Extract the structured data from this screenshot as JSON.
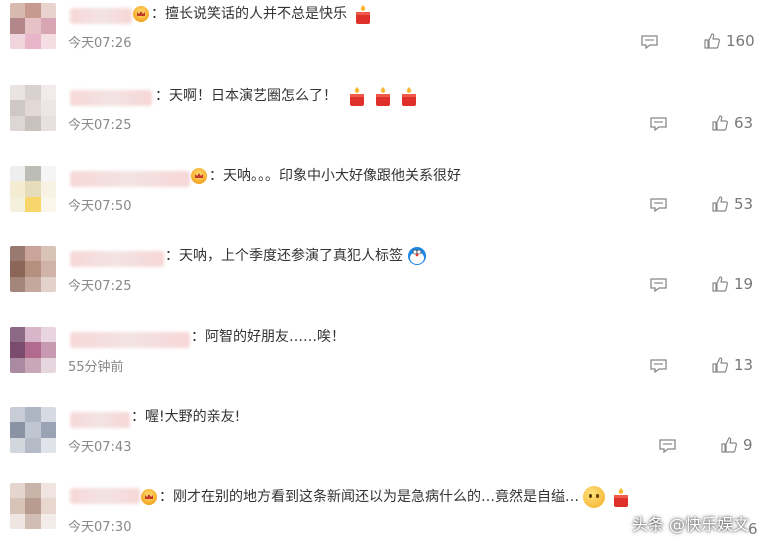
{
  "comments": [
    {
      "name_hidden": true,
      "badge": "vip-crown",
      "text": "：擅长说笑话的人并不总是快乐",
      "emoji": [
        "candle"
      ],
      "time": "今天07:26",
      "likes": "160"
    },
    {
      "name_hidden": true,
      "badge": "",
      "text": "：天啊！日本演艺圈怎么了！",
      "emoji": [
        "candle",
        "candle",
        "candle"
      ],
      "time": "今天07:25",
      "likes": "63"
    },
    {
      "name_hidden": true,
      "badge": "vip-crown",
      "text": "：天呐。。。印象中小大好像跟他关系很好",
      "emoji": [],
      "time": "今天07:50",
      "likes": "53"
    },
    {
      "name_hidden": true,
      "badge": "",
      "text": "：天呐，上个季度还参演了真犯人标签",
      "emoji": [
        "doraemon"
      ],
      "time": "今天07:25",
      "likes": "19"
    },
    {
      "name_hidden": true,
      "badge": "",
      "text": "：阿智的好朋友……唉！",
      "emoji": [],
      "time": "55分钟前",
      "likes": "13"
    },
    {
      "name_hidden": true,
      "badge": "",
      "text": "：喔!大野的亲友!",
      "emoji": [],
      "time": "今天07:43",
      "likes": "9"
    },
    {
      "name_hidden": true,
      "badge": "vip-crown",
      "text": "：刚才在别的地方看到这条新闻还以为是急病什么的…竟然是自缢…",
      "emoji": [
        "sad-face",
        "candle"
      ],
      "time": "今天07:30",
      "likes": "6"
    }
  ],
  "watermark": "头条 @快乐娱文",
  "colors": {
    "text": "#333333",
    "meta": "#888888",
    "badge": "#f5a623",
    "candle": "#e0302a"
  }
}
